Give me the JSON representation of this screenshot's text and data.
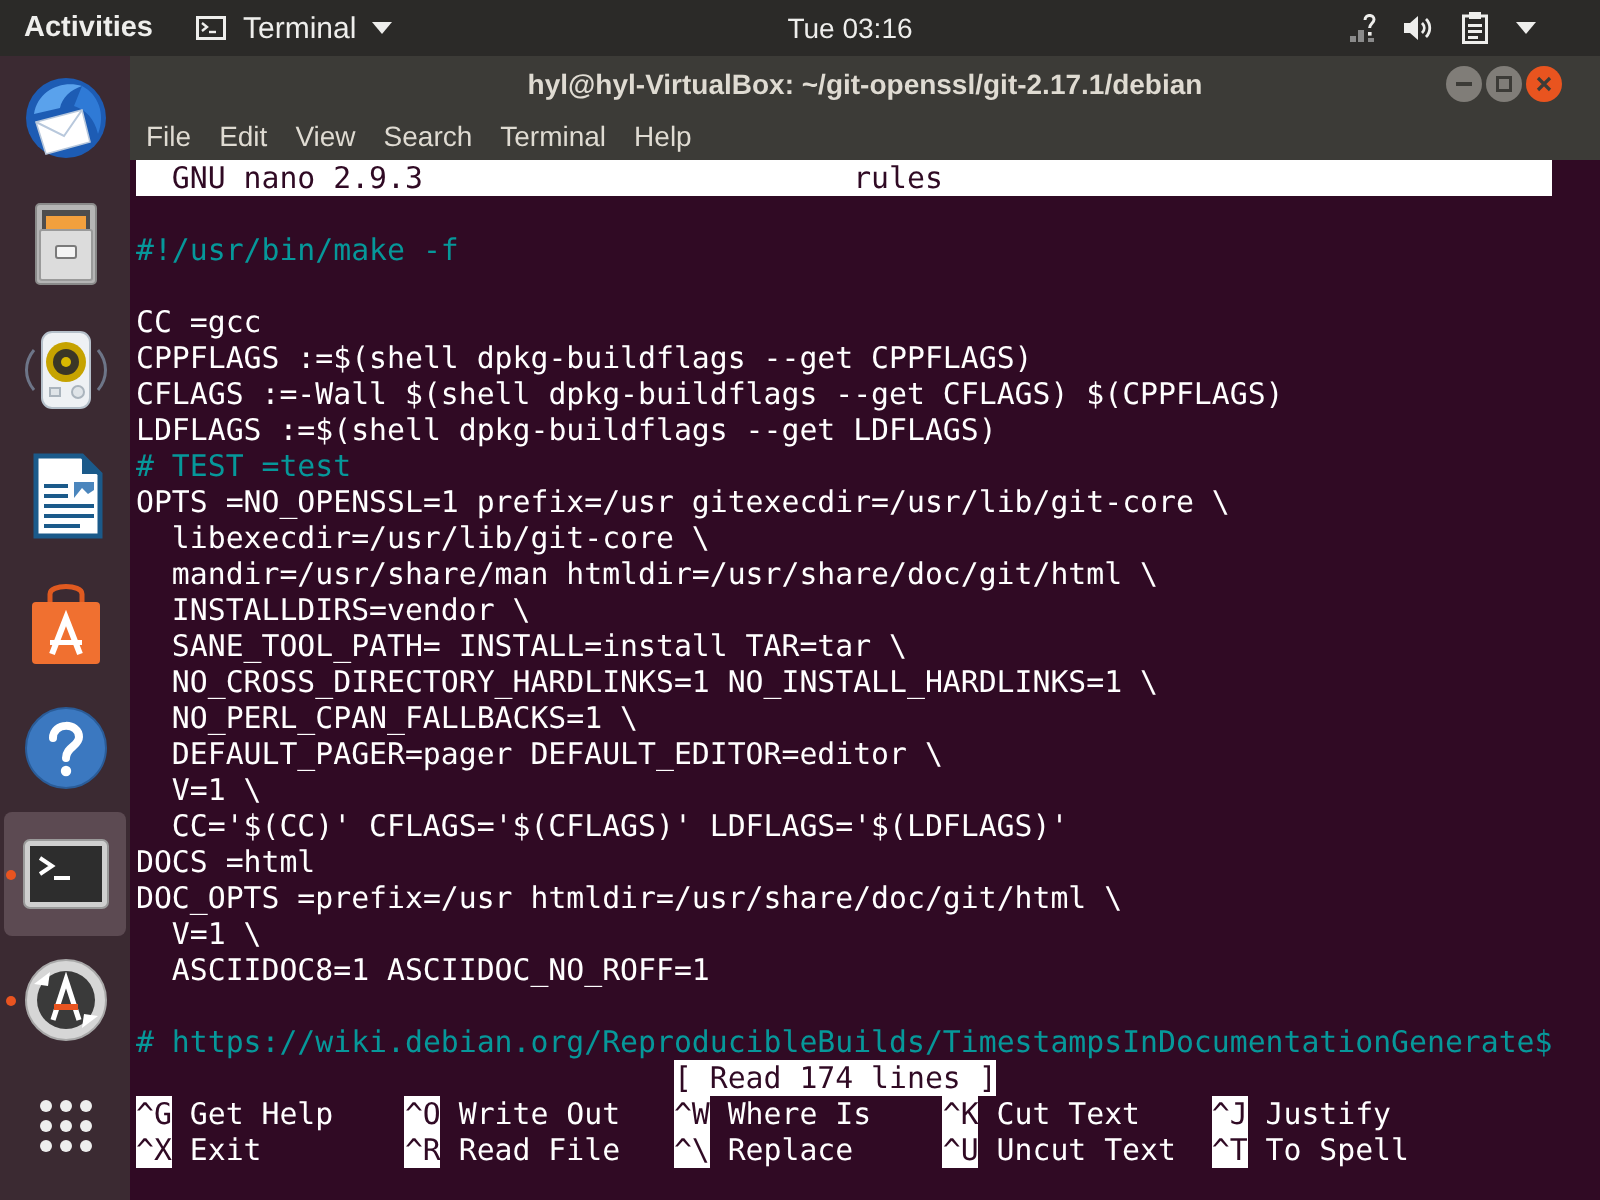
{
  "top_bar": {
    "activities": "Activities",
    "app_menu": "Terminal",
    "clock": "Tue 03:16"
  },
  "dock": {
    "items": [
      {
        "kind": "mail",
        "selected": false,
        "running": false
      },
      {
        "kind": "files",
        "selected": false,
        "running": false
      },
      {
        "kind": "music",
        "selected": false,
        "running": false
      },
      {
        "kind": "writer",
        "selected": false,
        "running": false
      },
      {
        "kind": "software",
        "selected": false,
        "running": false
      },
      {
        "kind": "help",
        "selected": false,
        "running": false
      },
      {
        "kind": "terminal",
        "selected": true,
        "running": true
      },
      {
        "kind": "updater",
        "selected": false,
        "running": true
      },
      {
        "kind": "apps",
        "selected": false,
        "running": false
      }
    ]
  },
  "window": {
    "title": "hyl@hyl-VirtualBox: ~/git-openssl/git-2.17.1/debian",
    "menu": [
      "File",
      "Edit",
      "View",
      "Search",
      "Terminal",
      "Help"
    ]
  },
  "nano": {
    "header": {
      "version": "GNU nano 2.9.3",
      "filename": "rules"
    },
    "lines": [
      {
        "kind": "blank"
      },
      {
        "kind": "comment",
        "text": "#!/usr/bin/make -f"
      },
      {
        "kind": "blank"
      },
      {
        "kind": "code",
        "text": "CC =gcc"
      },
      {
        "kind": "code",
        "text": "CPPFLAGS :=$(shell dpkg-buildflags --get CPPFLAGS)"
      },
      {
        "kind": "code",
        "text": "CFLAGS :=-Wall $(shell dpkg-buildflags --get CFLAGS) $(CPPFLAGS)"
      },
      {
        "kind": "code",
        "text": "LDFLAGS :=$(shell dpkg-buildflags --get LDFLAGS)"
      },
      {
        "kind": "comment",
        "text": "# TEST =test"
      },
      {
        "kind": "code",
        "text": "OPTS =NO_OPENSSL=1 prefix=/usr gitexecdir=/usr/lib/git-core \\",
        "children": [
          {
            "kind": "code",
            "text": "libexecdir=/usr/lib/git-core \\"
          },
          {
            "kind": "code",
            "text": "mandir=/usr/share/man htmldir=/usr/share/doc/git/html \\"
          },
          {
            "kind": "code",
            "text": "INSTALLDIRS=vendor \\"
          },
          {
            "kind": "code",
            "text": "SANE_TOOL_PATH= INSTALL=install TAR=tar \\"
          },
          {
            "kind": "code",
            "text": "NO_CROSS_DIRECTORY_HARDLINKS=1 NO_INSTALL_HARDLINKS=1 \\"
          },
          {
            "kind": "code",
            "text": "NO_PERL_CPAN_FALLBACKS=1 \\"
          },
          {
            "kind": "code",
            "text": "DEFAULT_PAGER=pager DEFAULT_EDITOR=editor \\"
          },
          {
            "kind": "code",
            "text": "V=1 \\"
          },
          {
            "kind": "code",
            "text": "CC='$(CC)' CFLAGS='$(CFLAGS)' LDFLAGS='$(LDFLAGS)'"
          }
        ]
      },
      {
        "kind": "code",
        "text": "DOCS =html"
      },
      {
        "kind": "code",
        "text": "DOC_OPTS =prefix=/usr htmldir=/usr/share/doc/git/html \\",
        "children": [
          {
            "kind": "code",
            "text": "V=1 \\"
          },
          {
            "kind": "code",
            "text": "ASCIIDOC8=1 ASCIIDOC_NO_ROFF=1"
          }
        ]
      },
      {
        "kind": "blank"
      },
      {
        "kind": "comment",
        "text": "# https://wiki.debian.org/ReproducibleBuilds/TimestampsInDocumentationGenerate$"
      }
    ],
    "status": "[ Read 174 lines ]",
    "shortcuts": [
      {
        "key": "^G",
        "label": "Get Help"
      },
      {
        "key": "^O",
        "label": "Write Out"
      },
      {
        "key": "^W",
        "label": "Where Is"
      },
      {
        "key": "^K",
        "label": "Cut Text"
      },
      {
        "key": "^J",
        "label": "Justify"
      },
      {
        "key": "^X",
        "label": "Exit"
      },
      {
        "key": "^R",
        "label": "Read File"
      },
      {
        "key": "^\\",
        "label": "Replace"
      },
      {
        "key": "^U",
        "label": "Uncut Text"
      },
      {
        "key": "^T",
        "label": "To Spell"
      }
    ]
  }
}
